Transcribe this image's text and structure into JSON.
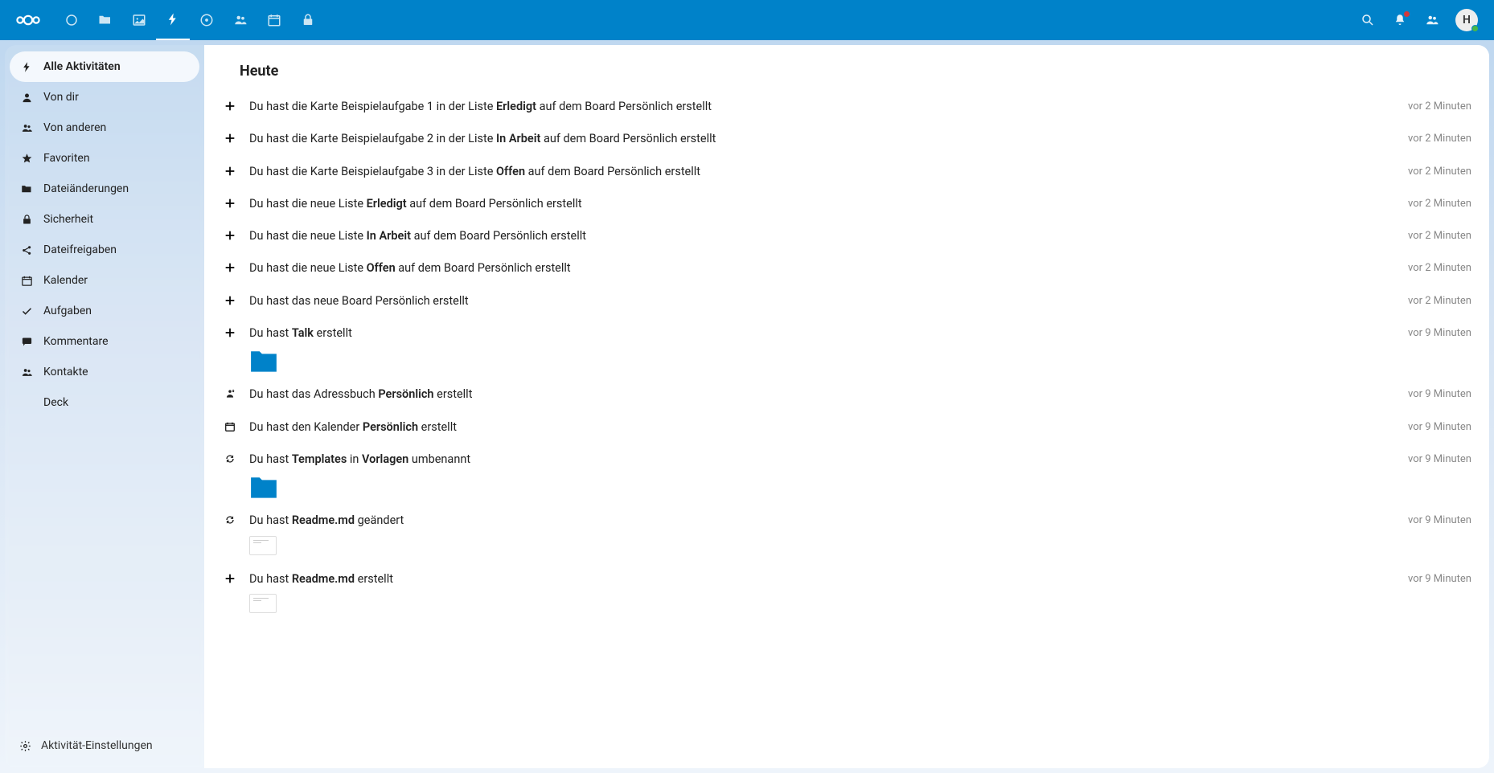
{
  "header": {
    "avatar_initial": "H"
  },
  "sidebar": {
    "items": [
      {
        "label": "Alle Aktivitäten",
        "icon": "bolt",
        "active": true
      },
      {
        "label": "Von dir",
        "icon": "user"
      },
      {
        "label": "Von anderen",
        "icon": "users"
      },
      {
        "label": "Favoriten",
        "icon": "star"
      },
      {
        "label": "Dateiänderungen",
        "icon": "folder"
      },
      {
        "label": "Sicherheit",
        "icon": "lock"
      },
      {
        "label": "Dateifreigaben",
        "icon": "share"
      },
      {
        "label": "Kalender",
        "icon": "calendar"
      },
      {
        "label": "Aufgaben",
        "icon": "check"
      },
      {
        "label": "Kommentare",
        "icon": "comment"
      },
      {
        "label": "Kontakte",
        "icon": "contact"
      },
      {
        "label": "Deck",
        "icon": ""
      }
    ],
    "settings_label": "Aktivität-Einstellungen"
  },
  "main": {
    "section_title": "Heute",
    "activities": [
      {
        "icon": "plus",
        "segments": [
          {
            "t": "Du hast die Karte Beispielaufgabe 1 in der Liste "
          },
          {
            "t": "Erledigt",
            "b": true
          },
          {
            "t": " auf dem Board Persönlich erstellt"
          }
        ],
        "time": "vor 2 Minuten"
      },
      {
        "icon": "plus",
        "segments": [
          {
            "t": "Du hast die Karte Beispielaufgabe 2 in der Liste "
          },
          {
            "t": "In Arbeit",
            "b": true
          },
          {
            "t": " auf dem Board Persönlich erstellt"
          }
        ],
        "time": "vor 2 Minuten"
      },
      {
        "icon": "plus",
        "segments": [
          {
            "t": "Du hast die Karte Beispielaufgabe 3 in der Liste "
          },
          {
            "t": "Offen",
            "b": true
          },
          {
            "t": " auf dem Board Persönlich erstellt"
          }
        ],
        "time": "vor 2 Minuten"
      },
      {
        "icon": "plus",
        "segments": [
          {
            "t": "Du hast die neue Liste "
          },
          {
            "t": "Erledigt",
            "b": true
          },
          {
            "t": " auf dem Board Persönlich erstellt"
          }
        ],
        "time": "vor 2 Minuten"
      },
      {
        "icon": "plus",
        "segments": [
          {
            "t": "Du hast die neue Liste "
          },
          {
            "t": "In Arbeit",
            "b": true
          },
          {
            "t": " auf dem Board Persönlich erstellt"
          }
        ],
        "time": "vor 2 Minuten"
      },
      {
        "icon": "plus",
        "segments": [
          {
            "t": "Du hast die neue Liste "
          },
          {
            "t": "Offen",
            "b": true
          },
          {
            "t": " auf dem Board Persönlich erstellt"
          }
        ],
        "time": "vor 2 Minuten"
      },
      {
        "icon": "plus",
        "segments": [
          {
            "t": "Du hast das neue Board Persönlich erstellt"
          }
        ],
        "time": "vor 2 Minuten"
      },
      {
        "icon": "plus",
        "segments": [
          {
            "t": "Du hast "
          },
          {
            "t": "Talk",
            "b": true
          },
          {
            "t": " erstellt"
          }
        ],
        "time": "vor 9 Minuten",
        "thumb": "folder"
      },
      {
        "icon": "download",
        "segments": [
          {
            "t": "Du hast das Adressbuch "
          },
          {
            "t": "Persönlich",
            "b": true
          },
          {
            "t": " erstellt"
          }
        ],
        "time": "vor 9 Minuten"
      },
      {
        "icon": "calendar",
        "segments": [
          {
            "t": "Du hast den Kalender "
          },
          {
            "t": "Persönlich",
            "b": true
          },
          {
            "t": " erstellt"
          }
        ],
        "time": "vor 9 Minuten"
      },
      {
        "icon": "sync",
        "segments": [
          {
            "t": "Du hast "
          },
          {
            "t": "Templates",
            "b": true
          },
          {
            "t": " in "
          },
          {
            "t": "Vorlagen",
            "b": true
          },
          {
            "t": " umbenannt"
          }
        ],
        "time": "vor 9 Minuten",
        "thumb": "folder"
      },
      {
        "icon": "sync",
        "segments": [
          {
            "t": "Du hast "
          },
          {
            "t": "Readme.md",
            "b": true
          },
          {
            "t": " geändert"
          }
        ],
        "time": "vor 9 Minuten",
        "thumb": "file"
      },
      {
        "icon": "plus",
        "segments": [
          {
            "t": "Du hast "
          },
          {
            "t": "Readme.md",
            "b": true
          },
          {
            "t": " erstellt"
          }
        ],
        "time": "vor 9 Minuten",
        "thumb": "file"
      }
    ]
  }
}
